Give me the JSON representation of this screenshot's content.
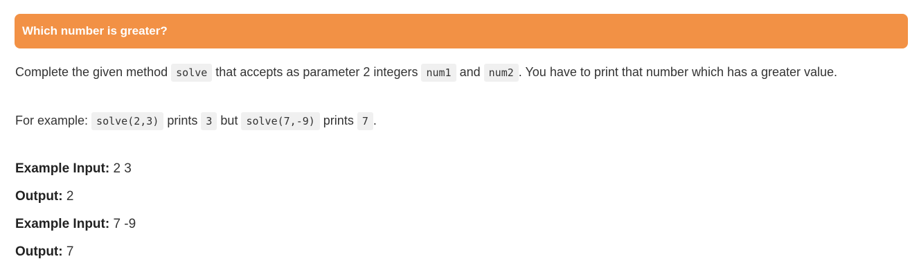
{
  "header": {
    "title": "Which number is greater?",
    "color": "#f29145"
  },
  "description": {
    "t1": "Complete the given method ",
    "code_solve": "solve",
    "t2": " that accepts as parameter 2 integers ",
    "code_num1": "num1",
    "t3": " and ",
    "code_num2": "num2",
    "t4": ". You have to print that number which has a greater value."
  },
  "example_line": {
    "t1": "For example: ",
    "code_call1": "solve(2,3)",
    "t2": " prints ",
    "code_res1": "3",
    "t3": " but ",
    "code_call2": "solve(7,-9)",
    "t4": " prints ",
    "code_res2": "7",
    "t5": "."
  },
  "examples": [
    {
      "label": "Example Input:",
      "value": " 2 3"
    },
    {
      "label": "Output:",
      "value": " 2"
    },
    {
      "label": "Example Input:",
      "value": " 7 -9"
    },
    {
      "label": "Output:",
      "value": " 7"
    }
  ]
}
